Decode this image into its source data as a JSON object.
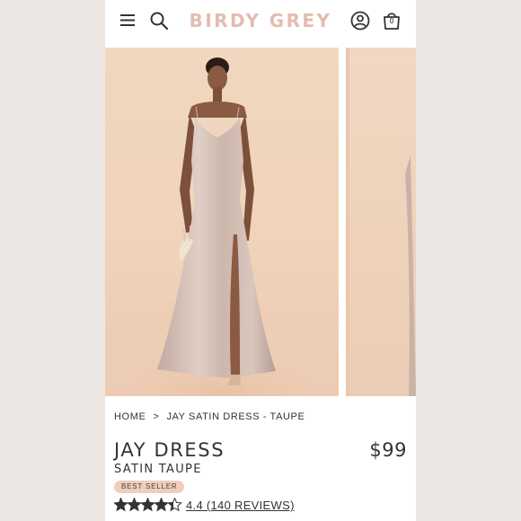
{
  "header": {
    "brand": "BIRDY GREY",
    "bag_count": "0",
    "brand_color": "#e3bcb1",
    "icons": [
      "menu-icon",
      "search-icon",
      "account-icon",
      "shopping-bag-icon"
    ]
  },
  "gallery": {
    "images": [
      "main-product-photo",
      "next-product-photo"
    ],
    "background_color": "#f0d3ba",
    "dress_color": "#cfb8ae"
  },
  "breadcrumb": {
    "home": "HOME",
    "separator": ">",
    "current": "JAY SATIN DRESS - TAUPE"
  },
  "product": {
    "title": "JAY DRESS",
    "price": "$99",
    "subtitle": "SATIN TAUPE",
    "badge": "BEST SELLER",
    "badge_color": "#f1cdbc",
    "rating": 4.4,
    "rating_max": 5,
    "rating_text": "4.4 (140 REVIEWS)"
  }
}
